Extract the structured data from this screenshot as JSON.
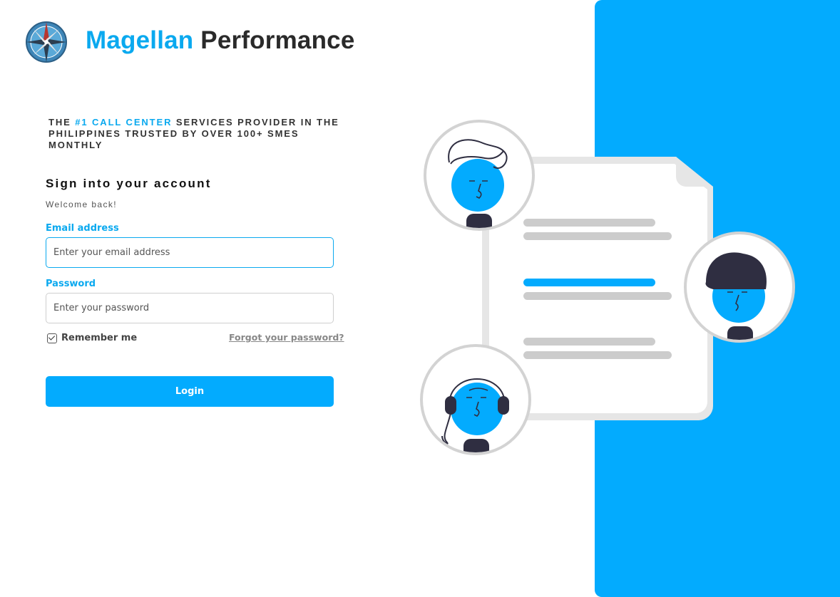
{
  "brand": {
    "name_part1": "Magellan",
    "name_part2": "Performance",
    "logo_icon": "compass-icon"
  },
  "tagline": {
    "prefix": "THE ",
    "highlight": "#1 CALL CENTER",
    "suffix": " SERVICES PROVIDER IN THE PHILIPPINES TRUSTED BY OVER 100+ SMES MONTHLY"
  },
  "signin": {
    "title": "Sign into your account",
    "subtitle": "Welcome back!",
    "email_label": "Email address",
    "email_placeholder": "Enter your email address",
    "password_label": "Password",
    "password_placeholder": "Enter your password",
    "remember_label": "Remember me",
    "remember_checked": true,
    "forgot_label": "Forgot your password?",
    "login_label": "Login"
  },
  "illustration": {
    "icon": "agents-document-illustration"
  },
  "colors": {
    "accent": "#03abfe",
    "brand_blue": "#0aa9ef",
    "dark": "#2a2a3a",
    "gray_line": "#cccccc"
  }
}
